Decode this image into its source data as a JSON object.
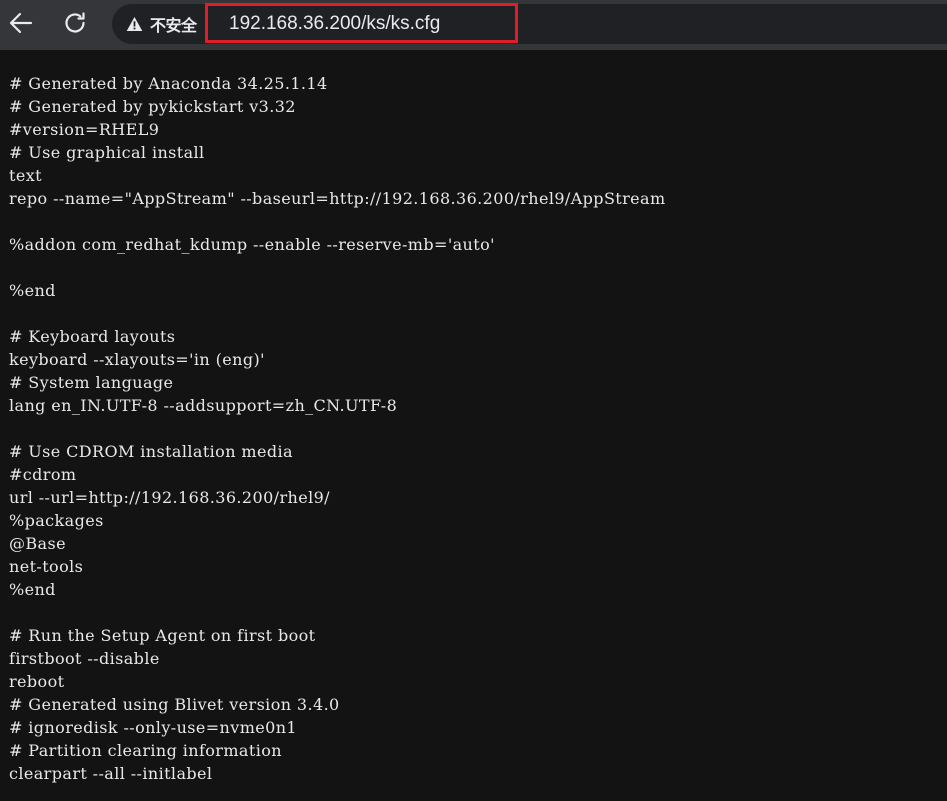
{
  "toolbar": {
    "security_label": "不安全",
    "url": "192.168.36.200/ks/ks.cfg"
  },
  "document": {
    "lines": [
      "# Generated by Anaconda 34.25.1.14",
      "# Generated by pykickstart v3.32",
      "#version=RHEL9",
      "# Use graphical install",
      "text",
      "repo --name=\"AppStream\" --baseurl=http://192.168.36.200/rhel9/AppStream",
      "",
      "%addon com_redhat_kdump --enable --reserve-mb='auto'",
      "",
      "%end",
      "",
      "# Keyboard layouts",
      "keyboard --xlayouts='in (eng)'",
      "# System language",
      "lang en_IN.UTF-8 --addsupport=zh_CN.UTF-8",
      "",
      "# Use CDROM installation media",
      "#cdrom",
      "url --url=http://192.168.36.200/rhel9/",
      "%packages",
      "@Base",
      "net-tools",
      "%end",
      "",
      "# Run the Setup Agent on first boot",
      "firstboot --disable",
      "reboot",
      "# Generated using Blivet version 3.4.0",
      "# ignoredisk --only-use=nvme0n1",
      "# Partition clearing information",
      "clearpart --all --initlabel"
    ]
  }
}
